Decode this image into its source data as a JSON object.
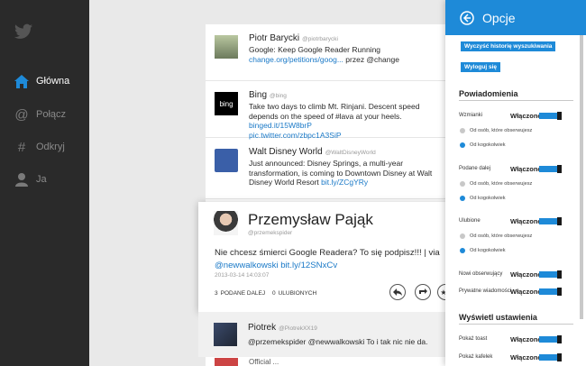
{
  "nav": {
    "items": [
      {
        "label": "Główna",
        "icon": "home-icon"
      },
      {
        "label": "Połącz",
        "icon": "at-icon"
      },
      {
        "label": "Odkryj",
        "icon": "hash-icon"
      },
      {
        "label": "Ja",
        "icon": "person-icon"
      }
    ]
  },
  "timeline": {
    "tweets": [
      {
        "name": "Piotr Barycki",
        "handle": "@piotrbarycki",
        "text": "Google: Keep Google Reader Running",
        "link": "change.org/petitions/goog...",
        "suffix": " przez @change"
      },
      {
        "name": "Bing",
        "handle": "@bing",
        "text": "Take two days to climb Mt. Rinjani. Descent speed depends on the speed of #lava at your heels.",
        "link": "binged.it/15W8brP",
        "link2": "pic.twitter.com/zbpc1A3SiP"
      },
      {
        "name": "Walt Disney World",
        "handle": "@WaltDisneyWorld",
        "text": "Just announced: Disney Springs, a multi-year transformation, is coming to Downtown Disney at Walt Disney World Resort",
        "link": "bit.ly/ZCgYRy"
      }
    ]
  },
  "card": {
    "name": "Przemysław Pająk",
    "handle": "@przemekspider",
    "text": "Nie chcesz śmierci Google Readera? To się podpisz!!! | via",
    "mention": "@newwalkowski",
    "link": "bit.ly/12SNxCv",
    "date": "2013-03-14 14:03:07",
    "retweets": "3",
    "retweets_label": "PODANE DALEJ",
    "favorites": "0",
    "favorites_label": "ULUBIONYCH"
  },
  "reply": {
    "name": "Piotrek",
    "handle": "@PiotrekXX19",
    "text": "@przemekspider @newwalkowski To i tak nic nie da."
  },
  "peek": {
    "text": "Official ..."
  },
  "pane": {
    "title": "Opcje",
    "clear_history": "Wyczyść historię wyszukiwania",
    "logout": "Wyloguj się",
    "notifications_title": "Powiadomienia",
    "rows": [
      {
        "label": "Wzmianki",
        "state": "Włączone",
        "opt1": "Od osób, które obserwujesz",
        "opt2": "Od kogokolwiek"
      },
      {
        "label": "Podane dalej",
        "state": "Włączone",
        "opt1": "Od osób, które obserwujesz",
        "opt2": "Od kogokolwiek"
      },
      {
        "label": "Ulubione",
        "state": "Włączone",
        "opt1": "Od osób, które obserwujesz",
        "opt2": "Od kogokolwiek"
      },
      {
        "label": "Nowi obserwujący",
        "state": "Włączone"
      },
      {
        "label": "Prywatne wiadomości",
        "state": "Włączone"
      }
    ],
    "display_title": "Wyświetl ustawienia",
    "display_rows": [
      {
        "label": "Pokaż toast",
        "state": "Włączone"
      },
      {
        "label": "Pokaż kafelek",
        "state": "Włączone"
      }
    ]
  },
  "colors": {
    "accent": "#1e8ad8",
    "nav_bg": "#2a2a2a",
    "link": "#1a79c7"
  }
}
